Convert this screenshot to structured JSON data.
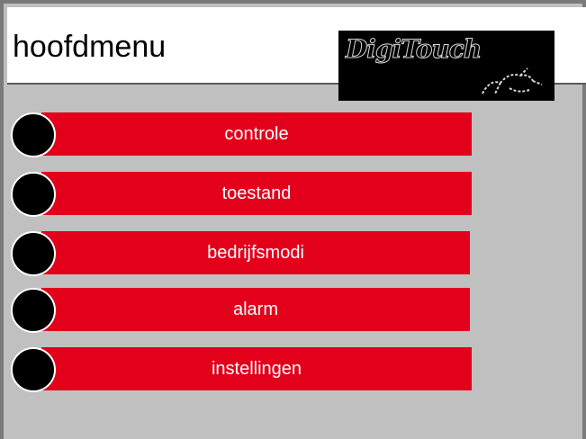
{
  "header": {
    "title": "hoofdmenu",
    "logo_text": "DigiTouch"
  },
  "menu": {
    "items": [
      {
        "label": "controle"
      },
      {
        "label": "toestand"
      },
      {
        "label": "bedrijfsmodi"
      },
      {
        "label": "alarm"
      },
      {
        "label": "instellingen"
      }
    ]
  },
  "colors": {
    "accent": "#e2001a",
    "background": "#c0c0c0",
    "knob": "#000000"
  }
}
